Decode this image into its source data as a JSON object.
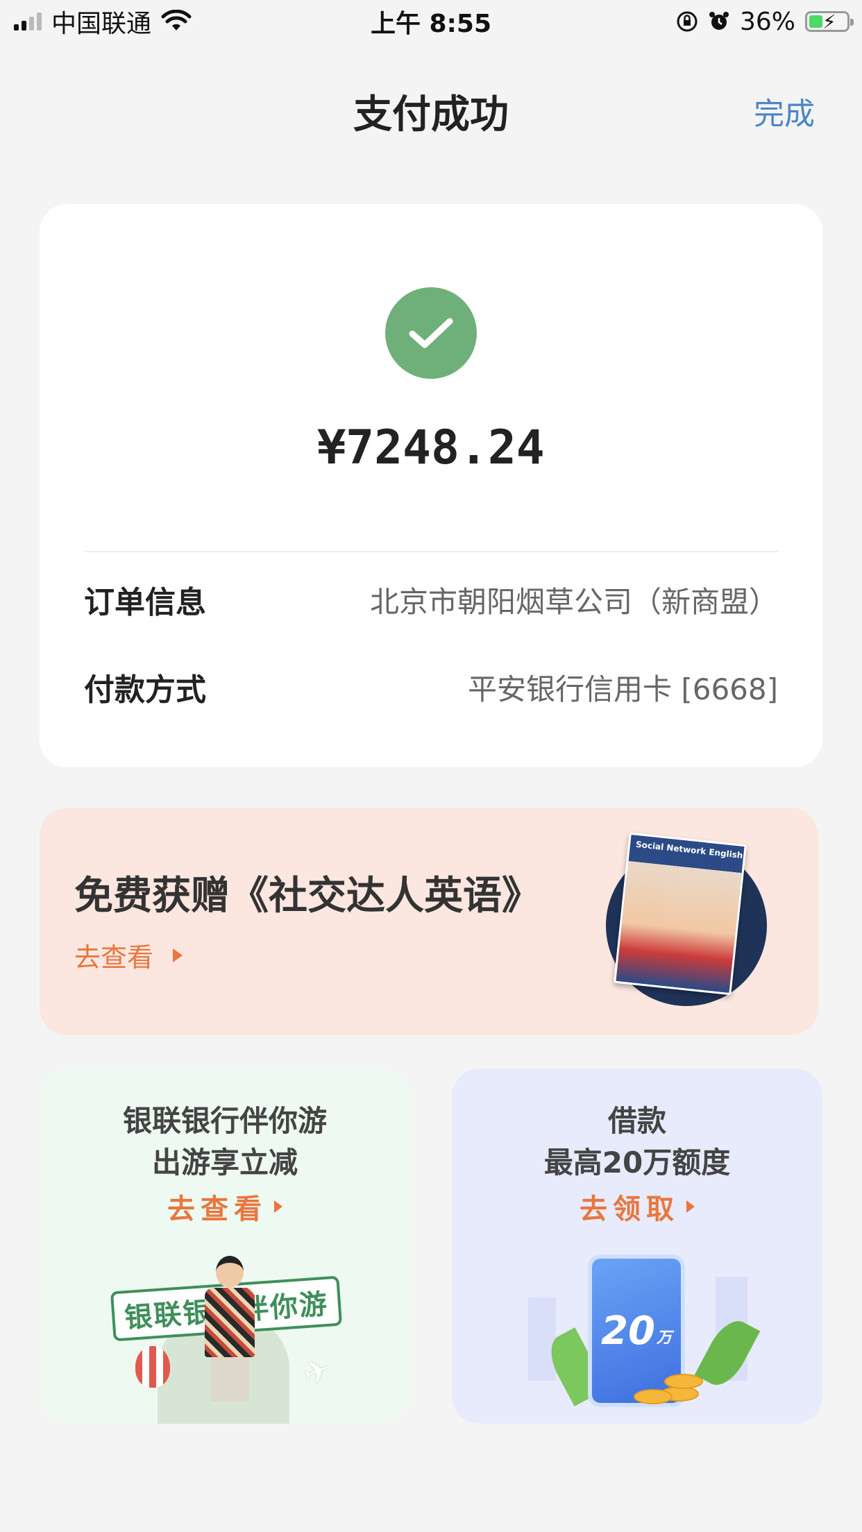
{
  "status_bar": {
    "carrier": "中国联通",
    "time": "上午 8:55",
    "battery_percent": "36%",
    "icons": [
      "signal-icon",
      "wifi-icon",
      "orientation-lock-icon",
      "alarm-icon",
      "battery-charging-icon"
    ]
  },
  "nav": {
    "title": "支付成功",
    "done_label": "完成"
  },
  "payment": {
    "status_icon": "check-icon",
    "amount": "¥7248.24",
    "rows": [
      {
        "label": "订单信息",
        "value": "北京市朝阳烟草公司（新商盟）"
      },
      {
        "label": "付款方式",
        "value": "平安银行信用卡 [6668]"
      }
    ]
  },
  "promo": {
    "title": "免费获赠《社交达人英语》",
    "link": "去查看",
    "book_title": "Social Network English"
  },
  "cards": {
    "left": {
      "line1": "银联银行伴你游",
      "line2": "出游享立减",
      "link": "去查看",
      "badge": "银联银行伴你游"
    },
    "right": {
      "line1": "借款",
      "line2": "最高20万额度",
      "link": "去领取",
      "phone_amount": "20",
      "phone_unit": "万"
    }
  },
  "colors": {
    "accent_blue": "#4a86c8",
    "success_green": "#6fb07a",
    "orange": "#e8773f"
  }
}
